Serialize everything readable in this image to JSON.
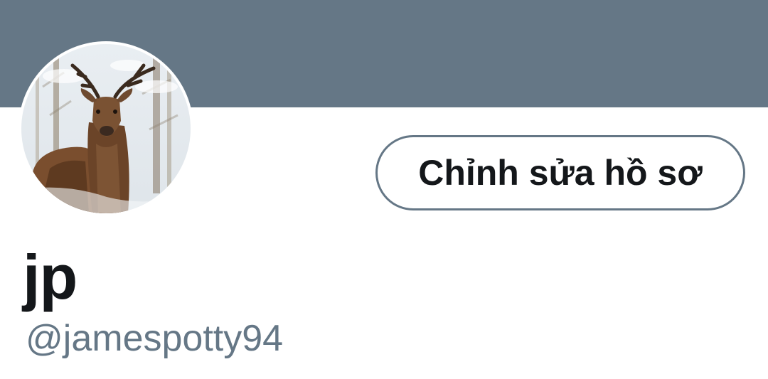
{
  "banner": {
    "color": "#657786"
  },
  "avatar": {
    "icon": "deer-photo"
  },
  "edit_profile": {
    "label": "Chỉnh sửa hồ sơ"
  },
  "profile": {
    "display_name": "jp",
    "handle": "@jamespotty94"
  },
  "colors": {
    "text_primary": "#14171a",
    "text_secondary": "#657786",
    "border": "#657786"
  }
}
